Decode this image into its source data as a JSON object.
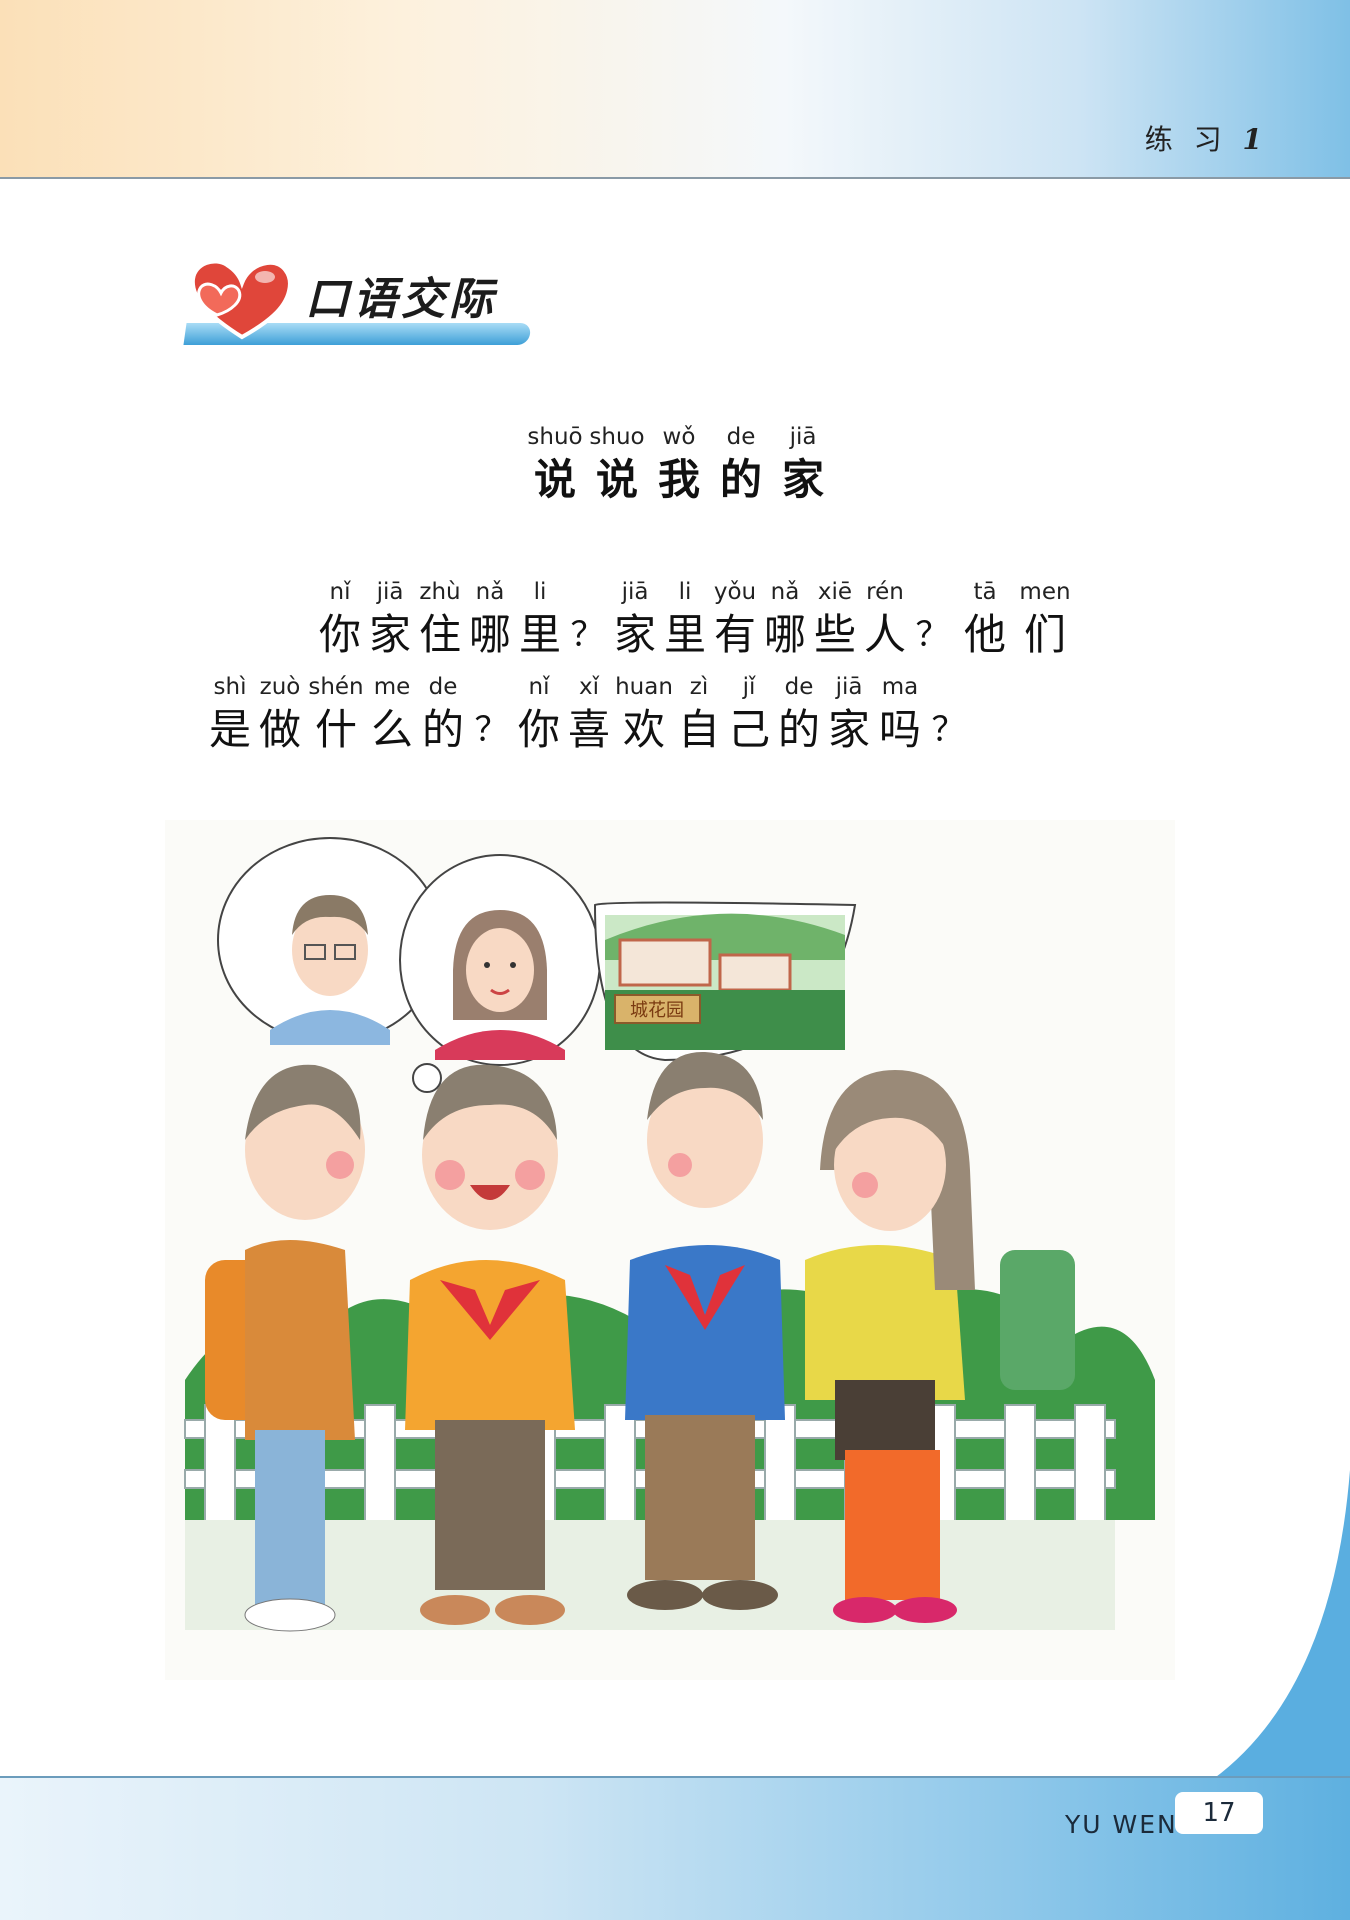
{
  "header": {
    "chapter_label": "练 习",
    "chapter_number": "1"
  },
  "section": {
    "heading": "口语交际"
  },
  "title": [
    {
      "py": "shuō",
      "hz": "说"
    },
    {
      "py": "shuo",
      "hz": "说"
    },
    {
      "py": "wǒ",
      "hz": "我"
    },
    {
      "py": "de",
      "hz": "的"
    },
    {
      "py": "jiā",
      "hz": "家"
    }
  ],
  "line1": [
    {
      "py": "nǐ",
      "hz": "你"
    },
    {
      "py": "jiā",
      "hz": "家"
    },
    {
      "py": "zhù",
      "hz": "住"
    },
    {
      "py": "nǎ",
      "hz": "哪"
    },
    {
      "py": "li",
      "hz": "里"
    },
    {
      "py": "",
      "hz": "？"
    },
    {
      "py": "jiā",
      "hz": "家"
    },
    {
      "py": "li",
      "hz": "里"
    },
    {
      "py": "yǒu",
      "hz": "有"
    },
    {
      "py": "nǎ",
      "hz": "哪"
    },
    {
      "py": "xiē",
      "hz": "些"
    },
    {
      "py": "rén",
      "hz": "人"
    },
    {
      "py": "",
      "hz": "？"
    },
    {
      "py": "tā",
      "hz": "他"
    },
    {
      "py": "men",
      "hz": "们"
    }
  ],
  "line2": [
    {
      "py": "shì",
      "hz": "是"
    },
    {
      "py": "zuò",
      "hz": "做"
    },
    {
      "py": "shén",
      "hz": "什"
    },
    {
      "py": "me",
      "hz": "么"
    },
    {
      "py": "de",
      "hz": "的"
    },
    {
      "py": "",
      "hz": "？"
    },
    {
      "py": "nǐ",
      "hz": "你"
    },
    {
      "py": "xǐ",
      "hz": "喜"
    },
    {
      "py": "huan",
      "hz": "欢"
    },
    {
      "py": "zì",
      "hz": "自"
    },
    {
      "py": "jǐ",
      "hz": "己"
    },
    {
      "py": "de",
      "hz": "的"
    },
    {
      "py": "jiā",
      "hz": "家"
    },
    {
      "py": "ma",
      "hz": "吗"
    },
    {
      "py": "",
      "hz": "？"
    }
  ],
  "illustration": {
    "sign_text": "城花园"
  },
  "footer": {
    "label": "YU WEN",
    "page_number": "17"
  },
  "colors": {
    "accent_blue": "#3e9fd7",
    "heart_red": "#e0463a"
  }
}
